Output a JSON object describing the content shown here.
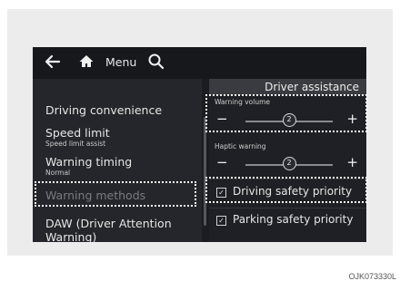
{
  "topbar": {
    "menu_label": "Menu"
  },
  "left_menu": {
    "items": [
      {
        "main": "Driving convenience",
        "sub": ""
      },
      {
        "main": "Speed limit",
        "sub": "Speed limit assist"
      },
      {
        "main": "Warning timing",
        "sub": "Normal"
      },
      {
        "main": "Warning methods",
        "sub": ""
      },
      {
        "main": "DAW (Driver Attention Warning)",
        "sub": ""
      }
    ]
  },
  "panel": {
    "header": "Driver assistance",
    "warning_volume": {
      "label": "Warning volume",
      "value": "2",
      "level_fraction": 0.5
    },
    "haptic_warning": {
      "label": "Haptic warning",
      "value": "2",
      "level_fraction": 0.5
    },
    "options": [
      {
        "label": "Driving safety priority",
        "checked": true
      },
      {
        "label": "Parking safety priority",
        "checked": true
      }
    ]
  },
  "caption": "OJK073330L"
}
